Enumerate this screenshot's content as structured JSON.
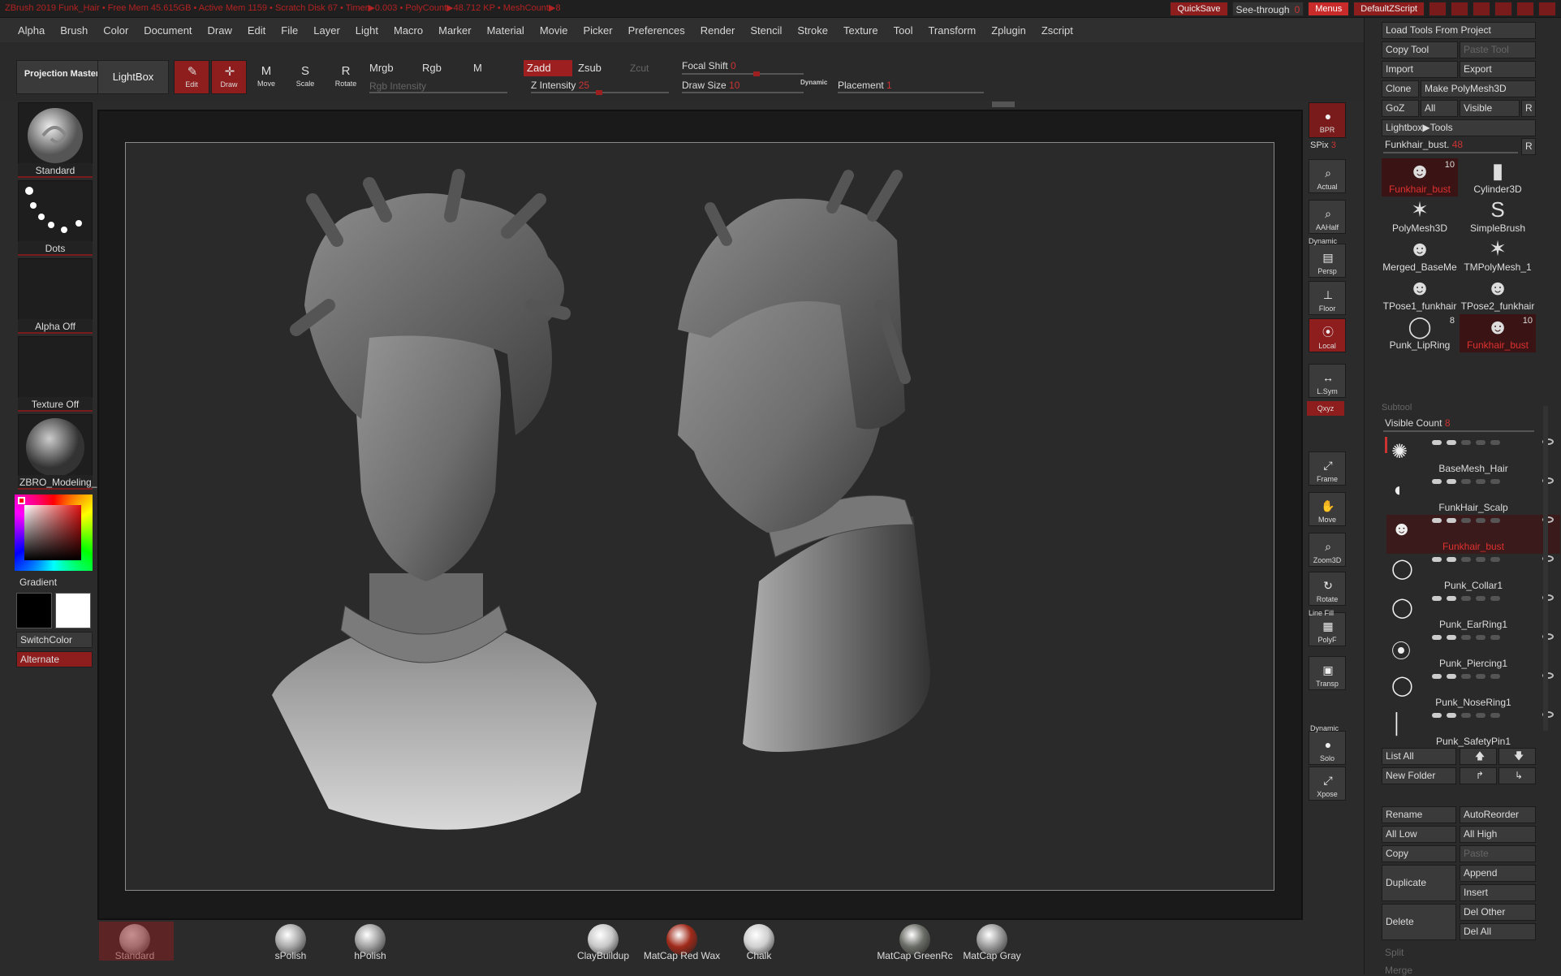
{
  "titlebar": {
    "status": "ZBrush 2019   Funk_Hair   • Free Mem 45.615GB • Active Mem 1159 • Scratch Disk 67 • Timer▶0.003 • PolyCount▶48.712 KP • MeshCount▶8",
    "quicksave": "QuickSave",
    "see_through_label": "See-through",
    "see_through_value": "0",
    "menus": "Menus",
    "default_script": "DefaultZScript"
  },
  "menubar": [
    "Alpha",
    "Brush",
    "Color",
    "Document",
    "Draw",
    "Edit",
    "File",
    "Layer",
    "Light",
    "Macro",
    "Marker",
    "Material",
    "Movie",
    "Picker",
    "Preferences",
    "Render",
    "Stencil",
    "Stroke",
    "Texture",
    "Tool",
    "Transform",
    "Zplugin",
    "Zscript"
  ],
  "shelf": {
    "projection_master": "Projection Master",
    "lightbox": "LightBox",
    "edit": "Edit",
    "draw": "Draw",
    "move": "Move",
    "scale": "Scale",
    "rotate": "Rotate",
    "mrgb": "Mrgb",
    "rgb": "Rgb",
    "m": "M",
    "rgb_intensity": "Rgb Intensity",
    "zadd": "Zadd",
    "zsub": "Zsub",
    "zcut": "Zcut",
    "z_intensity_label": "Z Intensity",
    "z_intensity_value": "25",
    "focal_shift_label": "Focal Shift",
    "focal_shift_value": "0",
    "draw_size_label": "Draw Size",
    "draw_size_value": "10",
    "dynamic": "Dynamic",
    "placement_label": "Placement",
    "placement_value": "1"
  },
  "leftpanel": {
    "brush": "Standard",
    "stroke": "Dots",
    "alpha": "Alpha Off",
    "texture": "Texture Off",
    "material": "ZBRO_Modeling_",
    "gradient": "Gradient",
    "switch_color": "SwitchColor",
    "alternate": "Alternate"
  },
  "rightstrip": {
    "bpr": "BPR",
    "spix_label": "SPix",
    "spix_value": "3",
    "buttons": [
      "Actual",
      "AAHalf",
      "Persp",
      "Floor",
      "Local",
      "L.Sym",
      "Frame",
      "Move",
      "Zoom3D",
      "Rotate",
      "PolyF",
      "Transp",
      "Solo",
      "Xpose"
    ],
    "dynamic": "Dynamic",
    "line_fill": "Line Fill",
    "xyz": "Qxyz"
  },
  "bottom_materials": [
    {
      "label": "Standard",
      "color": "#bbbbbb"
    },
    {
      "label": "sPolish",
      "color": "#a8a8a8"
    },
    {
      "label": "hPolish",
      "color": "#a0a0a0"
    },
    {
      "label": "ClayBuildup",
      "color": "#c8c8c8"
    },
    {
      "label": "MatCap Red Wax",
      "color": "#a02a1a"
    },
    {
      "label": "Chalk",
      "color": "#cfcfcf"
    },
    {
      "label": "MatCap GreenRc",
      "color": "#6a6c66"
    },
    {
      "label": "MatCap Gray",
      "color": "#9a9a9a"
    }
  ],
  "tool_panel": {
    "load_tools": "Load Tools From Project",
    "copy_tool": "Copy Tool",
    "paste_tool": "Paste Tool",
    "import": "Import",
    "export": "Export",
    "clone": "Clone",
    "make_polymesh": "Make PolyMesh3D",
    "goz": "GoZ",
    "all": "All",
    "visible": "Visible",
    "r": "R",
    "lightbox_tools": "Lightbox▶Tools",
    "current_tool_label": "Funkhair_bust.",
    "current_tool_value": "48",
    "tools": [
      {
        "name": "Funkhair_bust",
        "count": "10",
        "selected": true
      },
      {
        "name": "Cylinder3D",
        "count": ""
      },
      {
        "name": "PolyMesh3D",
        "count": ""
      },
      {
        "name": "SimpleBrush",
        "count": ""
      },
      {
        "name": "Merged_BaseMe",
        "count": ""
      },
      {
        "name": "TMPolyMesh_1",
        "count": ""
      },
      {
        "name": "TPose1_funkhair",
        "count": ""
      },
      {
        "name": "TPose2_funkhair",
        "count": ""
      },
      {
        "name": "Punk_LipRing",
        "count": "8"
      },
      {
        "name": "Funkhair_bust",
        "count": "10",
        "selected": true
      }
    ]
  },
  "subtool": {
    "header": "Subtool",
    "visible_count_label": "Visible Count",
    "visible_count_value": "8",
    "items": [
      "BaseMesh_Hair",
      "FunkHair_Scalp",
      "Funkhair_bust",
      "Punk_Collar1",
      "Punk_EarRing1",
      "Punk_Piercing1",
      "Punk_NoseRing1",
      "Punk_SafetyPin1"
    ],
    "selected_index": 2,
    "list_all": "List All",
    "new_folder": "New Folder",
    "rename": "Rename",
    "auto_reorder": "AutoReorder",
    "all_low": "All Low",
    "all_high": "All High",
    "copy": "Copy",
    "paste": "Paste",
    "duplicate": "Duplicate",
    "append": "Append",
    "insert": "Insert",
    "delete": "Delete",
    "del_other": "Del Other",
    "del_all": "Del All",
    "split": "Split",
    "merge": "Merge"
  },
  "colors": {
    "accent": "#8e1d1d",
    "highlight": "#e03030",
    "bg": "#2b2b2b"
  }
}
